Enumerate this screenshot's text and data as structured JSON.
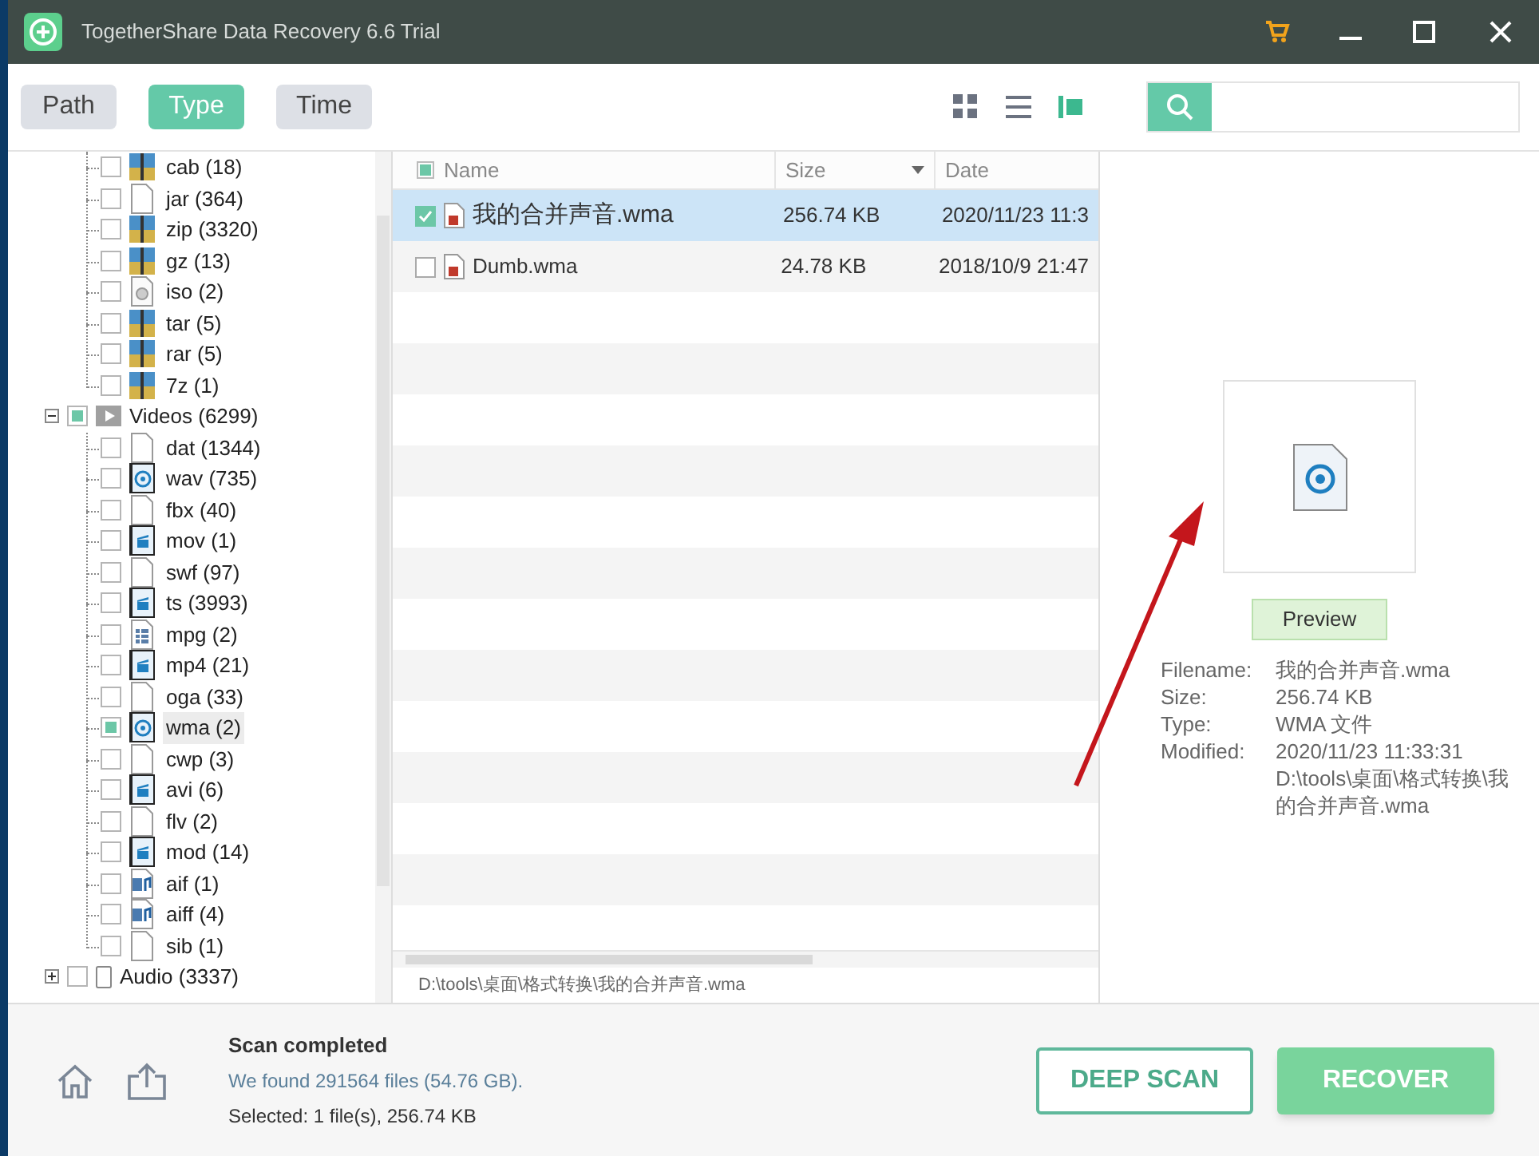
{
  "window": {
    "title": "TogetherShare Data Recovery 6.6 Trial"
  },
  "tabs": [
    {
      "label": "Path",
      "selected": false
    },
    {
      "label": "Type",
      "selected": true
    },
    {
      "label": "Time",
      "selected": false
    }
  ],
  "views": [
    {
      "kind": "grid",
      "selected": false
    },
    {
      "kind": "list",
      "selected": false
    },
    {
      "kind": "preview",
      "selected": true
    }
  ],
  "tree": [
    {
      "children": [
        {
          "label": "cab (18)",
          "kind": "archive",
          "checked": false
        },
        {
          "label": "jar (364)",
          "kind": "blank",
          "checked": false
        },
        {
          "label": "zip (3320)",
          "kind": "archive",
          "checked": false
        },
        {
          "label": "gz (13)",
          "kind": "archive",
          "checked": false
        },
        {
          "label": "iso (2)",
          "kind": "disc",
          "checked": false
        },
        {
          "label": "tar (5)",
          "kind": "archive",
          "checked": false
        },
        {
          "label": "rar (5)",
          "kind": "archive",
          "checked": false
        },
        {
          "label": "7z (1)",
          "kind": "archive",
          "checked": false
        }
      ]
    },
    {
      "label": "Videos (6299)",
      "kind": "folder-video",
      "checked": true,
      "expanded": true,
      "children": [
        {
          "label": "dat (1344)",
          "kind": "blank",
          "checked": false,
          "selected": false
        },
        {
          "label": "wav (735)",
          "kind": "sound",
          "checked": false,
          "selected": false
        },
        {
          "label": "fbx (40)",
          "kind": "blank",
          "checked": false,
          "selected": false
        },
        {
          "label": "mov (1)",
          "kind": "video",
          "checked": false,
          "selected": false
        },
        {
          "label": "swf (97)",
          "kind": "blank",
          "checked": false,
          "selected": false
        },
        {
          "label": "ts (3993)",
          "kind": "video",
          "checked": false,
          "selected": false
        },
        {
          "label": "mpg (2)",
          "kind": "film",
          "checked": false,
          "selected": false
        },
        {
          "label": "mp4 (21)",
          "kind": "video",
          "checked": false,
          "selected": false
        },
        {
          "label": "oga (33)",
          "kind": "blank",
          "checked": false,
          "selected": false
        },
        {
          "label": "wma (2)",
          "kind": "sound",
          "checked": true,
          "selected": true
        },
        {
          "label": "cwp (3)",
          "kind": "blank",
          "checked": false,
          "selected": false
        },
        {
          "label": "avi (6)",
          "kind": "video",
          "checked": false,
          "selected": false
        },
        {
          "label": "flv (2)",
          "kind": "blank",
          "checked": false,
          "selected": false
        },
        {
          "label": "mod (14)",
          "kind": "video",
          "checked": false,
          "selected": false
        },
        {
          "label": "aif (1)",
          "kind": "music",
          "checked": false,
          "selected": false
        },
        {
          "label": "aiff (4)",
          "kind": "music",
          "checked": false,
          "selected": false
        },
        {
          "label": "sib (1)",
          "kind": "blank",
          "checked": false,
          "selected": false
        }
      ]
    },
    {
      "label": "Audio (3337)",
      "kind": "folder-audio",
      "checked": false,
      "expanded": false
    }
  ],
  "table": {
    "columns": [
      "Name",
      "Size",
      "Date"
    ],
    "all_checked": true,
    "rows": [
      {
        "name": "我的合并声音.wma",
        "size": "256.74 KB",
        "date": "2020/11/23 11:3",
        "checked": true,
        "selected": true
      },
      {
        "name": "Dumb.wma",
        "size": "24.78 KB",
        "date": "2018/10/9 21:47",
        "checked": false,
        "selected": false
      }
    ]
  },
  "path_bar": "D:\\tools\\桌面\\格式转换\\我的合并声音.wma",
  "preview": {
    "button": "Preview",
    "fields": [
      {
        "label": "Filename:",
        "value": "我的合并声音.wma"
      },
      {
        "label": "Size:",
        "value": "256.74 KB"
      },
      {
        "label": "Type:",
        "value": "WMA 文件"
      },
      {
        "label": "Modified:",
        "value": "2020/11/23 11:33:31"
      }
    ],
    "path": "D:\\tools\\桌面\\格式转换\\我的合并声音.wma"
  },
  "status": {
    "title": "Scan completed",
    "found": "We found 291564 files (54.76 GB).",
    "selected": "Selected: 1 file(s), 256.74 KB"
  },
  "buttons": [
    {
      "label": "DEEP SCAN",
      "kind": "outline"
    },
    {
      "label": "RECOVER",
      "kind": "primary"
    }
  ]
}
